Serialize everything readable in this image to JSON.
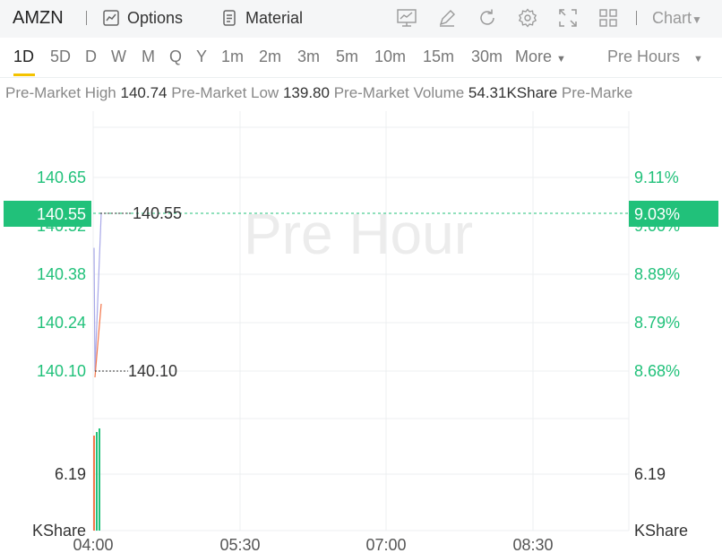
{
  "header": {
    "ticker": "AMZN",
    "options_label": "Options",
    "material_label": "Material",
    "chart_label": "Chart",
    "icons": [
      "trend-chart-icon",
      "draw-pen-icon",
      "refresh-icon",
      "settings-gear-icon",
      "fullscreen-icon",
      "grid-layout-icon"
    ]
  },
  "periods": {
    "items": [
      "1D",
      "5D",
      "D",
      "W",
      "M",
      "Q",
      "Y",
      "1m",
      "2m",
      "3m",
      "5m",
      "10m",
      "15m",
      "30m"
    ],
    "active": "1D",
    "more_label": "More",
    "session_label": "Pre Hours"
  },
  "stats": {
    "high_label": "Pre-Market High",
    "high_value": "140.74",
    "low_label": "Pre-Market Low",
    "low_value": "139.80",
    "volume_label": "Pre-Market Volume",
    "volume_value": "54.31KShare",
    "overflow_label": "Pre-Marke"
  },
  "chart": {
    "watermark": "Pre Hour",
    "price_ticks": [
      "140.65",
      "140.52",
      "140.38",
      "140.24",
      "140.10"
    ],
    "pct_ticks": [
      "9.11%",
      "9.00%",
      "8.89%",
      "8.79%",
      "8.68%"
    ],
    "current_price_tag": "140.55",
    "current_pct_tag": "9.03%",
    "high_marker": "140.55",
    "low_marker": "140.10",
    "volume_tick": "6.19",
    "volume_unit": "KShare",
    "time_ticks": [
      "04:00",
      "05:30",
      "07:00",
      "08:30"
    ],
    "colors": {
      "up": "#21c17a",
      "down": "#f3764a",
      "line": "#a8a8e8",
      "grid": "#eceff1"
    }
  },
  "chart_data": {
    "type": "line",
    "x": [
      "04:00",
      "04:01",
      "04:02"
    ],
    "series": [
      {
        "values": [
          140.45,
          140.1,
          140.55
        ]
      }
    ],
    "xlabel": "",
    "ylabel": "",
    "ylim": [
      140.1,
      140.65
    ]
  }
}
